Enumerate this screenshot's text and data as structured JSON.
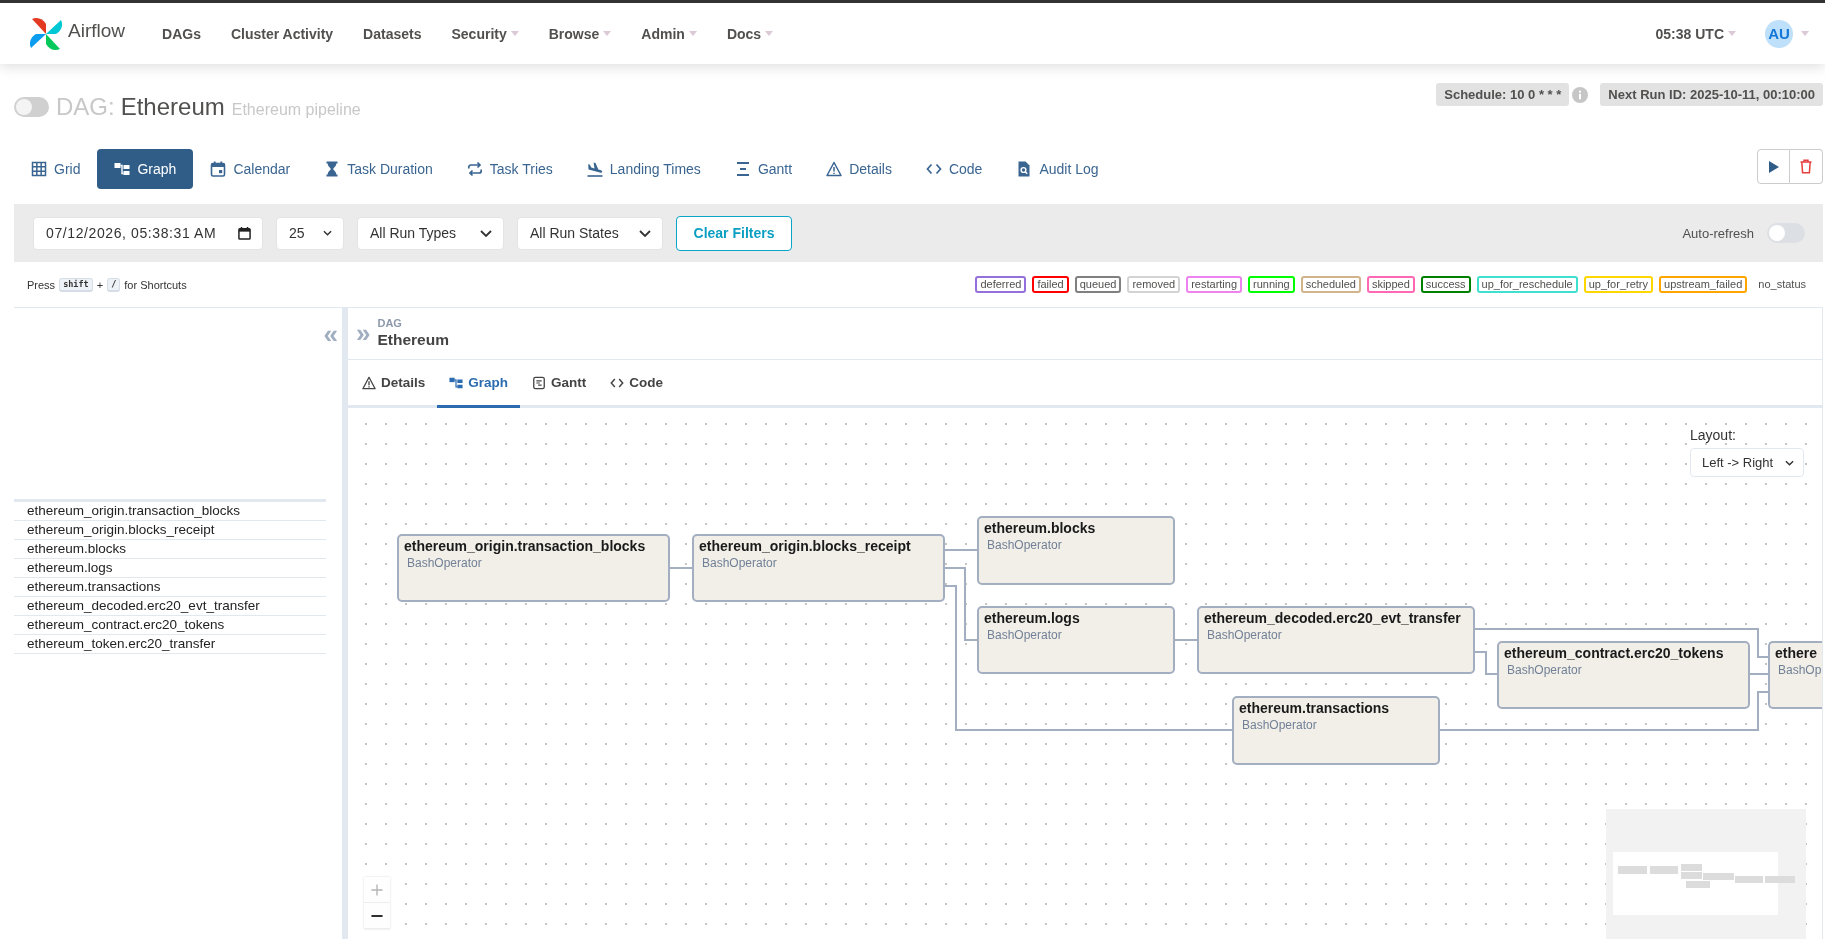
{
  "navbar": {
    "brand": "Airflow",
    "items": [
      {
        "label": "DAGs",
        "dropdown": false
      },
      {
        "label": "Cluster Activity",
        "dropdown": false
      },
      {
        "label": "Datasets",
        "dropdown": false
      },
      {
        "label": "Security",
        "dropdown": true
      },
      {
        "label": "Browse",
        "dropdown": true
      },
      {
        "label": "Admin",
        "dropdown": true
      },
      {
        "label": "Docs",
        "dropdown": true
      }
    ],
    "clock": {
      "label": "05:38 UTC",
      "dropdown": true
    },
    "user": {
      "initials": "AU",
      "dropdown": true
    }
  },
  "dag_header": {
    "switch": {
      "on": false
    },
    "prefix": "DAG:",
    "name": "Ethereum",
    "description": "Ethereum pipeline",
    "schedule": "Schedule: 10 0 * * *",
    "next_run": "Next Run ID: 2025-10-11, 00:10:00"
  },
  "view_tabs": [
    {
      "label": "Grid",
      "selected": false
    },
    {
      "label": "Graph",
      "selected": true
    },
    {
      "label": "Calendar",
      "selected": false
    },
    {
      "label": "Task Duration",
      "selected": false
    },
    {
      "label": "Task Tries",
      "selected": false
    },
    {
      "label": "Landing Times",
      "selected": false
    },
    {
      "label": "Gantt",
      "selected": false
    },
    {
      "label": "Details",
      "selected": false
    },
    {
      "label": "Code",
      "selected": false
    },
    {
      "label": "Audit Log",
      "selected": false
    }
  ],
  "filters": {
    "base_date": "07/12/2026, 05:38:31 AM",
    "num_runs": "25",
    "run_type": "All Run Types",
    "run_state": "All Run States",
    "clear_button": "Clear Filters",
    "auto_refresh": {
      "label": "Auto-refresh",
      "on": false
    }
  },
  "shortcut_hint": {
    "press": "Press",
    "keys": [
      "shift",
      "/"
    ],
    "plus": "+",
    "suffix": "for Shortcuts"
  },
  "legend": [
    {
      "label": "deferred",
      "color": "#9370db"
    },
    {
      "label": "failed",
      "color": "#ff0000"
    },
    {
      "label": "queued",
      "color": "#808080"
    },
    {
      "label": "removed",
      "color": "#d3d3d3"
    },
    {
      "label": "restarting",
      "color": "#ee82ee"
    },
    {
      "label": "running",
      "color": "#00ff00"
    },
    {
      "label": "scheduled",
      "color": "#d2b48c"
    },
    {
      "label": "skipped",
      "color": "#ff69b4"
    },
    {
      "label": "success",
      "color": "#008000"
    },
    {
      "label": "up_for_reschedule",
      "color": "#40e0d0"
    },
    {
      "label": "up_for_retry",
      "color": "#ffd700"
    },
    {
      "label": "upstream_failed",
      "color": "#ffa500"
    },
    {
      "label": "no_status"
    }
  ],
  "task_list": {
    "collapse": "«",
    "tasks": [
      "ethereum_origin.transaction_blocks",
      "ethereum_origin.blocks_receipt",
      "ethereum.blocks",
      "ethereum.logs",
      "ethereum.transactions",
      "ethereum_decoded.erc20_evt_transfer",
      "ethereum_contract.erc20_tokens",
      "ethereum_token.erc20_transfer"
    ]
  },
  "details_panel": {
    "expand": "»",
    "breadcrumb_label": "DAG",
    "breadcrumb_value": "Ethereum",
    "tabs": [
      {
        "label": "Details",
        "selected": false
      },
      {
        "label": "Graph",
        "selected": true
      },
      {
        "label": "Gantt",
        "selected": false
      },
      {
        "label": "Code",
        "selected": false
      }
    ]
  },
  "graph": {
    "layout_label": "Layout:",
    "layout_value": "Left -> Right",
    "nodes": [
      {
        "title": "ethereum_origin.transaction_blocks",
        "operator": "BashOperator"
      },
      {
        "title": "ethereum_origin.blocks_receipt",
        "operator": "BashOperator"
      },
      {
        "title": "ethereum.blocks",
        "operator": "BashOperator"
      },
      {
        "title": "ethereum.logs",
        "operator": "BashOperator"
      },
      {
        "title": "ethereum_decoded.erc20_evt_transfer",
        "operator": "BashOperator"
      },
      {
        "title": "ethereum.transactions",
        "operator": "BashOperator"
      },
      {
        "title": "ethereum_contract.erc20_tokens",
        "operator": "BashOperator"
      },
      {
        "title": "ethere",
        "operator": "BashOp"
      }
    ],
    "zoom_controls": [
      {
        "disabled": true
      },
      {
        "disabled": false
      }
    ]
  }
}
